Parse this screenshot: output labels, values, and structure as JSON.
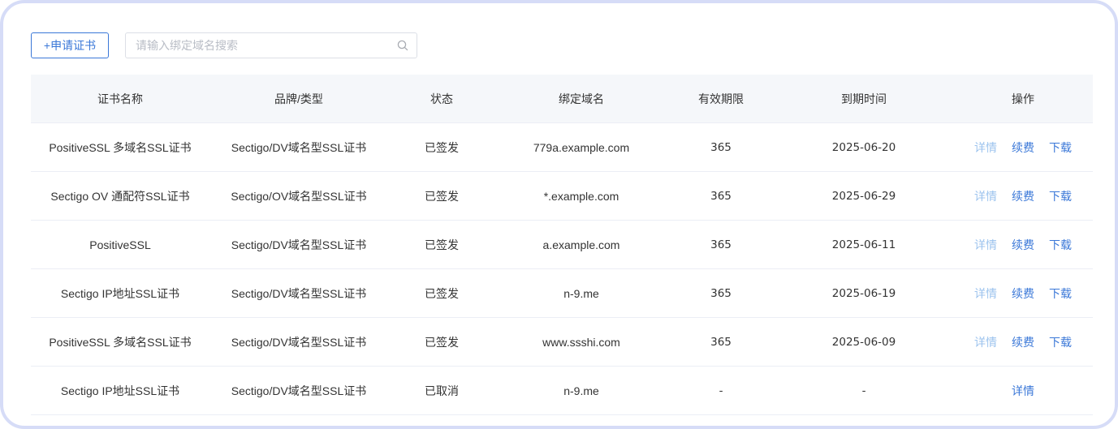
{
  "toolbar": {
    "apply_label": "+申请证书",
    "search_placeholder": "请输入绑定域名搜索"
  },
  "table": {
    "headers": [
      "证书名称",
      "品牌/类型",
      "状态",
      "绑定域名",
      "有效期限",
      "到期时间",
      "操作"
    ],
    "rows": [
      {
        "name": "PositiveSSL 多域名SSL证书",
        "brand": "Sectigo/DV域名型SSL证书",
        "status": "已签发",
        "domain": "779a.example.com",
        "validity": "365",
        "expire": "2025-06-20",
        "ops": {
          "detail": "详情",
          "renew": "续费",
          "download": "下载"
        }
      },
      {
        "name": "Sectigo OV 通配符SSL证书",
        "brand": "Sectigo/OV域名型SSL证书",
        "status": "已签发",
        "domain": "*.example.com",
        "validity": "365",
        "expire": "2025-06-29",
        "ops": {
          "detail": "详情",
          "renew": "续费",
          "download": "下载"
        }
      },
      {
        "name": "PositiveSSL",
        "brand": "Sectigo/DV域名型SSL证书",
        "status": "已签发",
        "domain": "a.example.com",
        "validity": "365",
        "expire": "2025-06-11",
        "ops": {
          "detail": "详情",
          "renew": "续费",
          "download": "下载"
        }
      },
      {
        "name": "Sectigo IP地址SSL证书",
        "brand": "Sectigo/DV域名型SSL证书",
        "status": "已签发",
        "domain": "n-9.me",
        "validity": "365",
        "expire": "2025-06-19",
        "ops": {
          "detail": "详情",
          "renew": "续费",
          "download": "下载"
        }
      },
      {
        "name": "PositiveSSL 多域名SSL证书",
        "brand": "Sectigo/DV域名型SSL证书",
        "status": "已签发",
        "domain": "www.ssshi.com",
        "validity": "365",
        "expire": "2025-06-09",
        "ops": {
          "detail": "详情",
          "renew": "续费",
          "download": "下载"
        }
      },
      {
        "name": "Sectigo IP地址SSL证书",
        "brand": "Sectigo/DV域名型SSL证书",
        "status": "已取消",
        "domain": "n-9.me",
        "validity": "-",
        "expire": "-",
        "ops": {
          "detail": "详情"
        }
      }
    ]
  },
  "colors": {
    "accent": "#3b78d8",
    "link_muted": "#9cc3ee",
    "frame_border": "#d6dcf7",
    "header_bg": "#f5f7fa"
  },
  "icons": {
    "search": "search-icon"
  }
}
